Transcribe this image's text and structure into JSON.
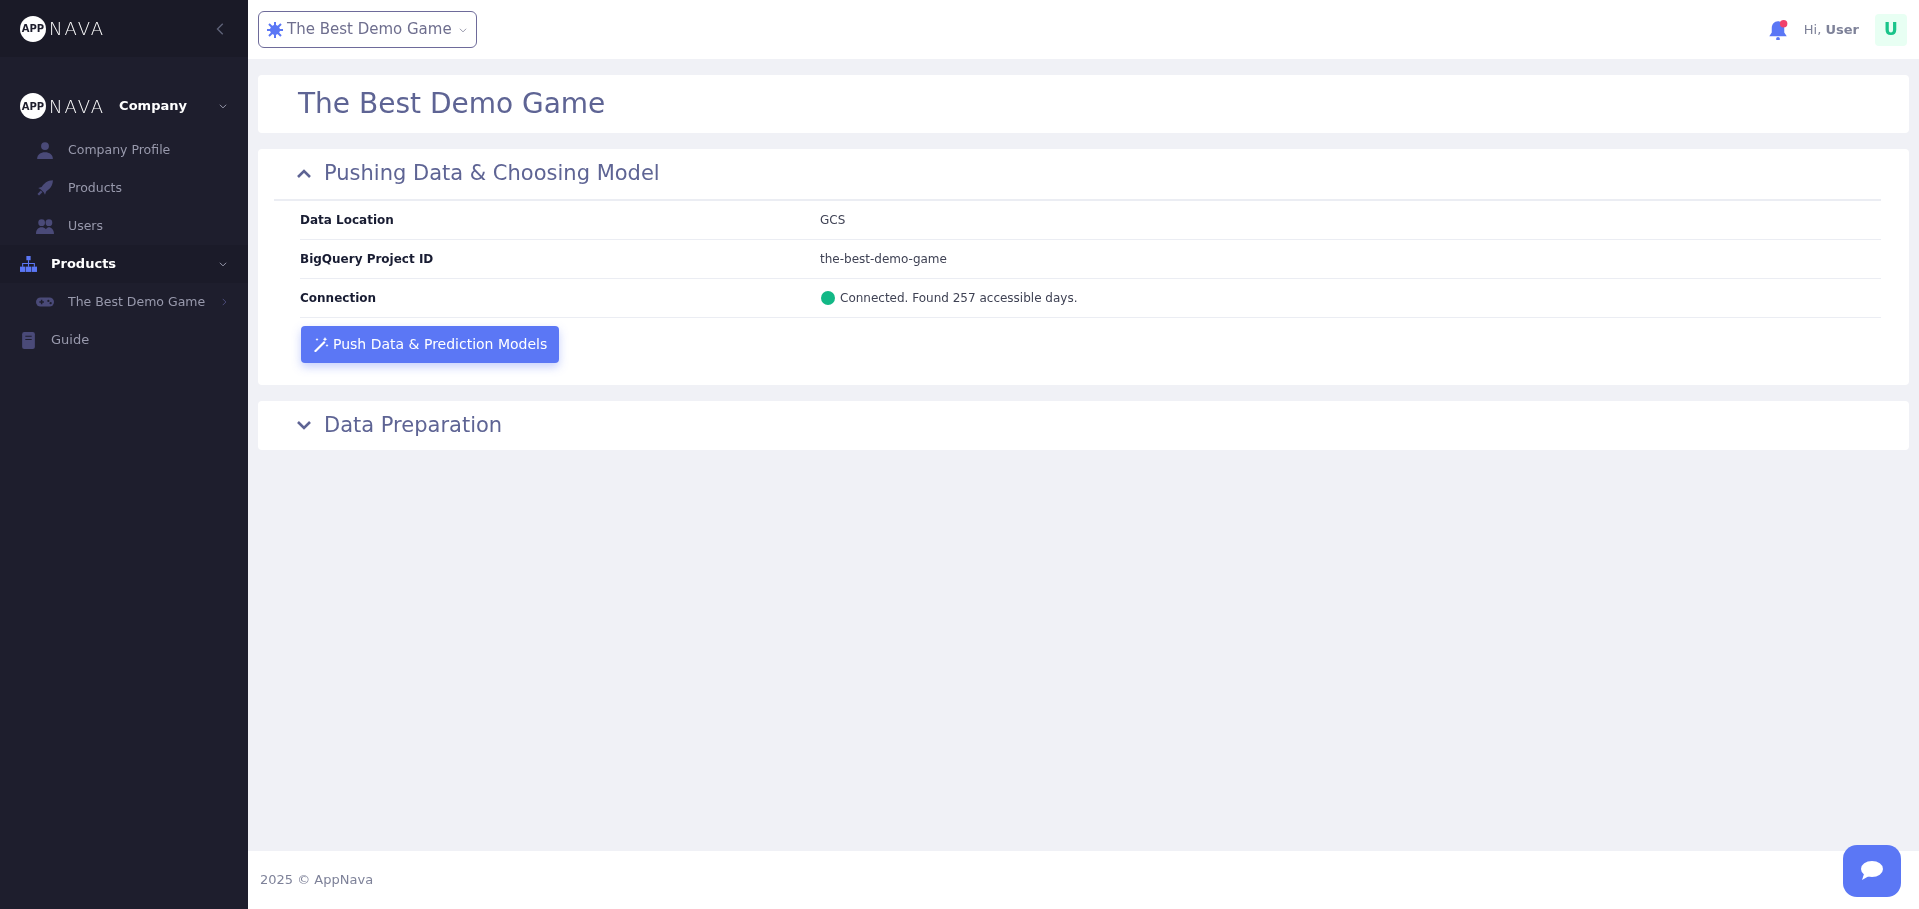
{
  "sidebar": {
    "logo": {
      "badge": "APP",
      "word": "NAVA"
    },
    "groups": [
      {
        "kind": "company",
        "logo": {
          "badge": "APP",
          "word": "NAVA"
        },
        "label": "Company",
        "expanded": true,
        "children": [
          {
            "label": "Company Profile"
          },
          {
            "label": "Products"
          },
          {
            "label": "Users"
          }
        ]
      },
      {
        "kind": "section",
        "label": "Products",
        "expanded": true,
        "selected": true,
        "children": [
          {
            "label": "The Best Demo Game"
          }
        ]
      },
      {
        "kind": "link",
        "label": "Guide",
        "selected": false
      }
    ]
  },
  "header": {
    "product_selector": "The Best Demo Game",
    "greeting": "Hi,",
    "user": "User",
    "avatar": "U",
    "notification": true
  },
  "page_title": "The Best Demo Game",
  "sections": [
    {
      "title": "Pushing Data & Choosing Model",
      "expanded": true,
      "rows": [
        {
          "kind": "text",
          "label": "Data Location",
          "value": "GCS"
        },
        {
          "kind": "text",
          "label": "BigQuery Project ID",
          "value": "the-best-demo-game"
        },
        {
          "kind": "status",
          "label": "Connection",
          "value": "Connected. Found 257 accessible days."
        }
      ],
      "button": "Push Data & Prediction Models"
    },
    {
      "title": "Data Preparation",
      "expanded": false
    }
  ],
  "footer": "2025 © AppNava"
}
